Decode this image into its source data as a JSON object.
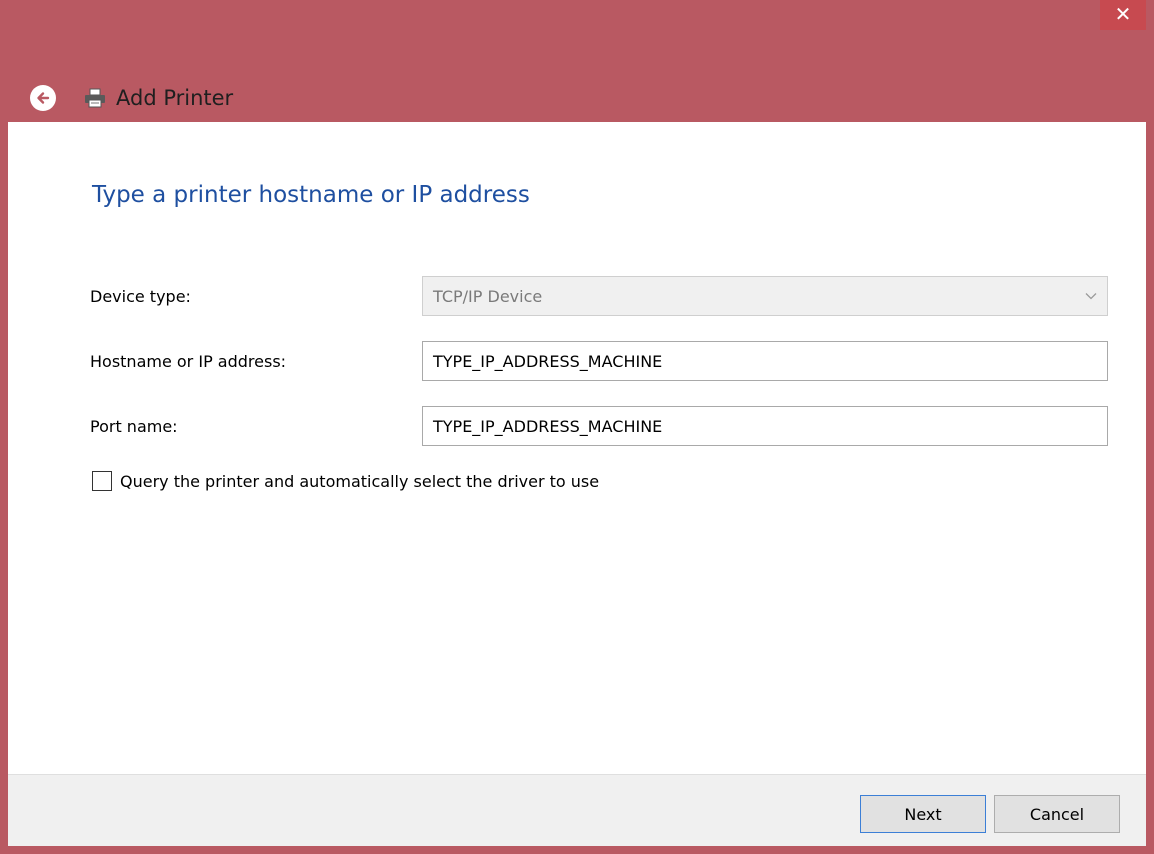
{
  "window": {
    "title": "Add Printer",
    "close_label": "✕"
  },
  "page": {
    "heading": "Type a printer hostname or IP address"
  },
  "form": {
    "device_type": {
      "label": "Device type:",
      "value": "TCP/IP Device"
    },
    "hostname": {
      "label": "Hostname or IP address:",
      "value": "TYPE_IP_ADDRESS_MACHINE"
    },
    "port": {
      "label": "Port name:",
      "value": "TYPE_IP_ADDRESS_MACHINE"
    },
    "query_checkbox": {
      "label": "Query the printer and automatically select the driver to use",
      "checked": false
    }
  },
  "footer": {
    "next_label": "Next",
    "cancel_label": "Cancel"
  },
  "icons": [
    "back-arrow-icon",
    "printer-icon",
    "close-icon",
    "chevron-down-icon"
  ],
  "colors": {
    "titlebar": "#b95962",
    "close_button": "#c74a50",
    "heading": "#1e4fa0"
  }
}
